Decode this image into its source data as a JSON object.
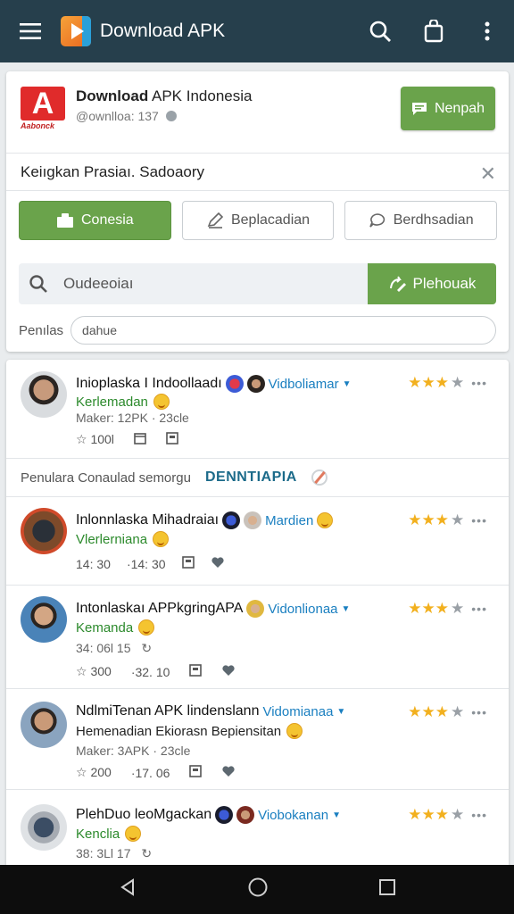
{
  "appbar": {
    "title": "Download APK"
  },
  "app": {
    "logo_caption": "Aabonck",
    "name_bold": "Download",
    "name_rest": " APK Indonesia",
    "handle": "@ownlloa: 137",
    "action_label": "Nenpah"
  },
  "notice": {
    "text": "Keiıgkan Prasiaı. Sadoaory"
  },
  "tabs": [
    {
      "label": "Conesia",
      "active": true
    },
    {
      "label": "Beplacadian",
      "active": false
    },
    {
      "label": "Berdhsadian",
      "active": false
    }
  ],
  "search": {
    "value": "Oudeeoiaı",
    "button_label": "Plehouak"
  },
  "filter": {
    "label": "Penılas",
    "value": "dahue"
  },
  "section": {
    "text": "Penulara Conaulad semorgu",
    "brand": "DENNTIAPIA"
  },
  "items": [
    {
      "title": "Inioplaska I Indoollaadı",
      "link": "Vidboliamar",
      "subtitle": "Kerlemadan",
      "meta": "Maker: 12PK · 23cle",
      "stat1": "100l",
      "rating": 3
    },
    {
      "title": "Inlonnlaska Mihadraiaı",
      "link": "Mardien",
      "subtitle": "Vlerlerniana",
      "stat1": "14: 30",
      "stat2": "·14: 30",
      "rating": 3
    },
    {
      "title": "Intonlaskaı APPkgringAPA",
      "link": "Vidonlionaa",
      "subtitle": "Kemanda",
      "meta": "34: 06l      15",
      "stat1": "300",
      "stat2": "·32. 10",
      "rating": 3
    },
    {
      "title": "NdlmiTenan APK lindenslann",
      "link": "Vidomianaa",
      "subtitle": "Hemenadian Ekiorasn Bepiensitan",
      "meta": "Maker: 3APK · 23cle",
      "stat1": "200",
      "stat2": "·17. 06",
      "rating": 3
    },
    {
      "title": "PlehDuo leoMgackan",
      "link": "Viobokanan",
      "subtitle": "Kenclia",
      "meta": "38: 3Ll      17",
      "rating": 3
    }
  ],
  "colors": {
    "appbar": "#263f4c",
    "accent_green": "#6aa34b",
    "link_blue": "#1a7fc0",
    "star": "#f2b01e"
  }
}
